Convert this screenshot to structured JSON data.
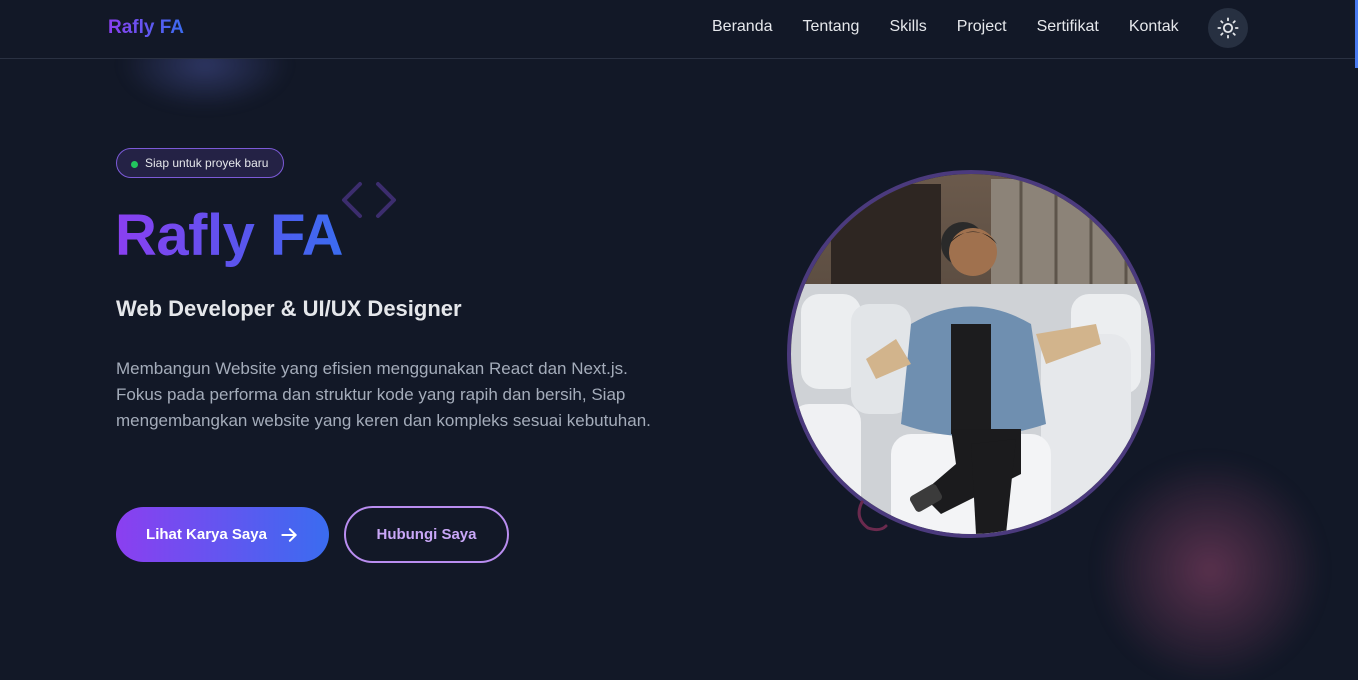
{
  "navbar": {
    "brand": "Rafly FA",
    "links": [
      {
        "label": "Beranda"
      },
      {
        "label": "Tentang"
      },
      {
        "label": "Skills"
      },
      {
        "label": "Project"
      },
      {
        "label": "Sertifikat"
      },
      {
        "label": "Kontak"
      }
    ],
    "theme_toggle_icon": "sun-icon"
  },
  "hero": {
    "badge": "Siap untuk proyek baru",
    "name": "Rafly FA",
    "role": "Web Developer & UI/UX Designer",
    "description": "Membangun Website yang efisien menggunakan React dan Next.js. Fokus pada performa dan struktur kode yang rapih dan bersih, Siap mengembangkan website yang keren dan kompleks sesuai kebutuhan.",
    "primary_button": "Lihat Karya Saya",
    "secondary_button": "Hubungi Saya",
    "photo_icon": "profile-photo"
  },
  "colors": {
    "background": "#121827",
    "accent_purple": "#8b3ff0",
    "accent_blue": "#3a6cf0",
    "status_green": "#22c55e",
    "text_muted": "#a4acba"
  }
}
